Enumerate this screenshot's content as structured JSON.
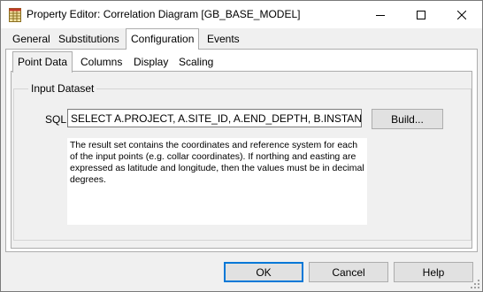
{
  "window": {
    "title": "Property Editor: Correlation Diagram [GB_BASE_MODEL]",
    "icons": {
      "app": "grid-app-icon",
      "minimize": "minimize-icon",
      "maximize": "maximize-icon",
      "close": "close-icon"
    }
  },
  "main_tabs": [
    {
      "label": "General",
      "active": false
    },
    {
      "label": "Substitutions",
      "active": false
    },
    {
      "label": "Configuration",
      "active": true
    },
    {
      "label": "Events",
      "active": false
    }
  ],
  "sub_tabs": [
    {
      "label": "Point Data",
      "active": true
    },
    {
      "label": "Columns",
      "active": false
    },
    {
      "label": "Display",
      "active": false
    },
    {
      "label": "Scaling",
      "active": false
    }
  ],
  "input_dataset": {
    "group_title": "Input Dataset",
    "sql_label": "SQL",
    "sql_value": "SELECT  A.PROJECT, A.SITE_ID, A.END_DEPTH, B.INSTANCE, B.C",
    "build_label": "Build...",
    "description": "The result set contains the coordinates and reference system for each of the input points (e.g. collar coordinates). If northing and easting are expressed as latitude and longitude, then the values must be in decimal degrees."
  },
  "buttons": {
    "ok": "OK",
    "cancel": "Cancel",
    "help": "Help"
  },
  "colors": {
    "accent": "#0078d7",
    "face": "#f0f0f0",
    "button": "#e1e1e1"
  }
}
